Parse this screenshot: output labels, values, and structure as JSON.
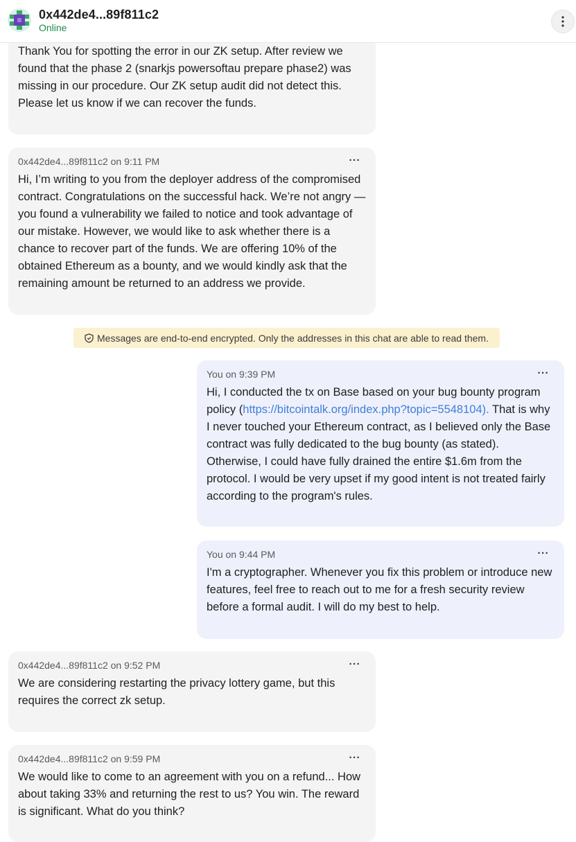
{
  "header": {
    "name": "0x442de4...89f811c2",
    "status": "Online",
    "menu_icon": "more-vertical-icon"
  },
  "notice": {
    "icon": "shield-icon",
    "text": "Messages are end-to-end encrypted. Only the addresses in this chat are able to read them."
  },
  "messages": [
    {
      "sender": "",
      "meta": "",
      "text": "Thank You for spotting the error in our ZK setup. After review we found that the phase 2 (snarkjs powersoftau prepare phase2) was missing in our procedure. Our ZK setup audit did not detect this. Please let us know if we can recover the funds."
    },
    {
      "meta": "0x442de4...89f811c2 on 9:11 PM",
      "text": "Hi, I’m writing to you from the deployer address of the compromised contract. Congratulations on the successful hack. We’re not angry — you found a vulnerability we failed to notice and took advantage of our mistake. However, we would like to ask whether there is a chance to recover part of the funds. We are offering 10% of the obtained Ethereum as a bounty, and we would kindly ask that the remaining amount be returned to an address we provide."
    },
    {
      "meta": "You on 9:39 PM",
      "text_before": "Hi, I conducted the tx on Base based on your bug bounty program policy (",
      "link": "https://bitcointalk.org/index.php?topic=5548104).",
      "text_after": " That is why I never touched your Ethereum contract, as I believed only the Base contract was fully dedicated to the bug bounty (as stated). Otherwise, I could have fully drained the entire $1.6m from the protocol. I would be very upset if my good intent is not treated fairly according to the program's rules."
    },
    {
      "meta": "You on 9:44 PM",
      "text": "I'm a cryptographer. Whenever you fix this problem or introduce new features, feel free to reach out to me for a fresh security review before a formal audit. I will do my best to help."
    },
    {
      "meta": "0x442de4...89f811c2 on 9:52 PM",
      "text": "We are considering restarting the privacy lottery game, but this requires the correct zk setup."
    },
    {
      "meta": "0x442de4...89f811c2 on 9:59 PM",
      "text": "We would like to come to an agreement with you on a refund... How about taking 33% and returning the rest to us? You win. The reward is significant. What do you think?"
    }
  ],
  "menu_glyph": "···"
}
